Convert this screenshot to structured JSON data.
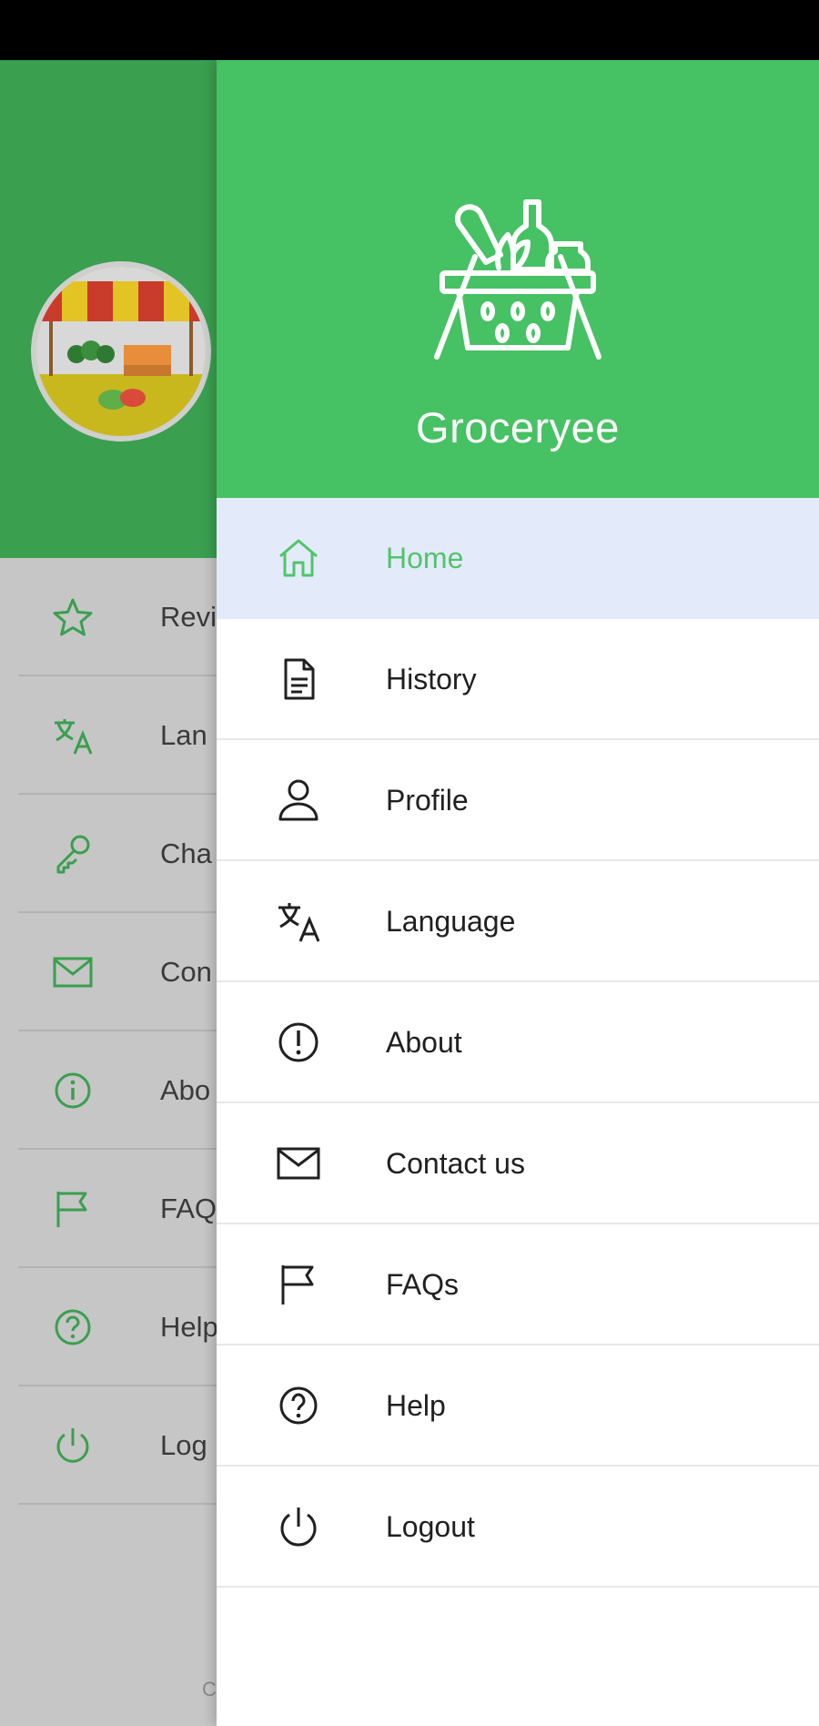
{
  "app": {
    "name": "Groceryee"
  },
  "colors": {
    "primary": "#46c163",
    "active_bg": "#e3ebfb",
    "active_text": "#52c46b"
  },
  "drawer": {
    "title": "Groceryee",
    "logo_icon": "grocery-basket-icon",
    "items": [
      {
        "label": "Home",
        "icon": "home-icon",
        "active": true
      },
      {
        "label": "History",
        "icon": "document-icon",
        "active": false
      },
      {
        "label": "Profile",
        "icon": "person-icon",
        "active": false
      },
      {
        "label": "Language",
        "icon": "translate-icon",
        "active": false
      },
      {
        "label": "About",
        "icon": "info-icon",
        "active": false
      },
      {
        "label": "Contact us",
        "icon": "mail-icon",
        "active": false
      },
      {
        "label": "FAQs",
        "icon": "flag-icon",
        "active": false
      },
      {
        "label": "Help",
        "icon": "help-icon",
        "active": false
      },
      {
        "label": "Logout",
        "icon": "power-icon",
        "active": false
      }
    ]
  },
  "background": {
    "avatar_icon": "market-stall-icon",
    "items": [
      {
        "label": "Revi",
        "icon": "star-icon"
      },
      {
        "label": "Lan",
        "icon": "translate-icon"
      },
      {
        "label": "Cha",
        "icon": "key-icon"
      },
      {
        "label": "Con",
        "icon": "mail-icon"
      },
      {
        "label": "Abo",
        "icon": "info-icon"
      },
      {
        "label": "FAQ",
        "icon": "flag-icon"
      },
      {
        "label": "Help",
        "icon": "help-icon"
      },
      {
        "label": "Log",
        "icon": "power-icon"
      }
    ],
    "footer_text": "C"
  }
}
